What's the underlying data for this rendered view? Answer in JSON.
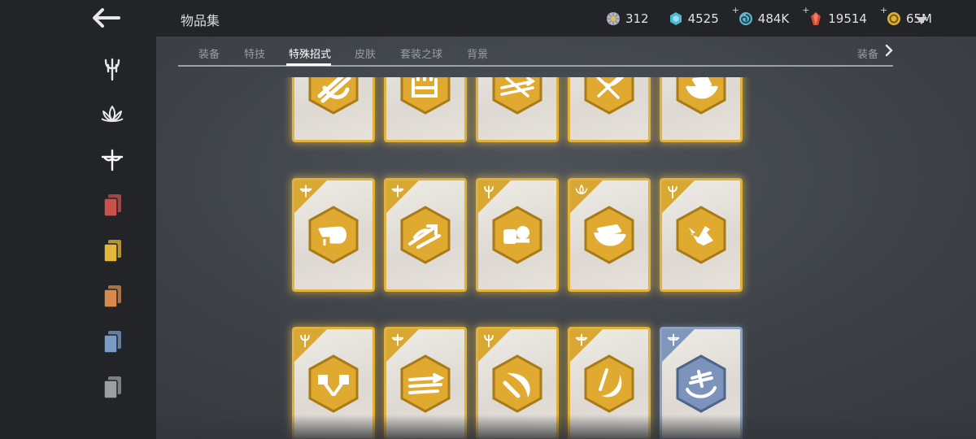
{
  "header": {
    "title": "物品集",
    "currencies": [
      {
        "icon": "prism-orb-icon",
        "value": "312",
        "color": "#c9a8e0"
      },
      {
        "icon": "cyan-hexagon-icon",
        "value": "4525",
        "color": "#4fb6d6"
      },
      {
        "icon": "swirl-orb-icon",
        "value": "484K",
        "color": "#63b6cc"
      },
      {
        "icon": "red-crystal-icon",
        "value": "19514",
        "color": "#d84a3a"
      },
      {
        "icon": "gold-coin-icon",
        "value": "65M",
        "color": "#d9b23a"
      }
    ]
  },
  "tabs": {
    "items": [
      "装备",
      "特技",
      "特殊招式",
      "皮肤",
      "套装之球",
      "背景"
    ],
    "active": "特殊招式",
    "right_label": "装备"
  },
  "sidebar": {
    "items": [
      {
        "icon": "trident-class-icon"
      },
      {
        "icon": "lotus-class-icon"
      },
      {
        "icon": "dragonfly-class-icon",
        "active": true
      },
      {
        "icon": "red-cards-icon",
        "color": "#c9534b"
      },
      {
        "icon": "yellow-cards-icon",
        "color": "#e4b63b"
      },
      {
        "icon": "orange-cards-icon",
        "color": "#d98a4e"
      },
      {
        "icon": "blue-cards-icon",
        "color": "#7b9cc9"
      },
      {
        "icon": "grey-cards-icon",
        "color": "#9c9ea3"
      }
    ]
  },
  "cards": {
    "rows": [
      [
        {
          "corner": "none",
          "symbol": "blade-slash-icon",
          "rarity": "gold"
        },
        {
          "corner": "none",
          "symbol": "castle-strike-icon",
          "rarity": "gold"
        },
        {
          "corner": "none",
          "symbol": "sword-arrows-icon",
          "rarity": "gold"
        },
        {
          "corner": "none",
          "symbol": "crossed-bow-icon",
          "rarity": "gold"
        },
        {
          "corner": "none",
          "symbol": "sweeping-kick-icon",
          "rarity": "gold"
        }
      ],
      [
        {
          "corner": "dragonfly-icon",
          "symbol": "fist-strike-icon",
          "rarity": "gold"
        },
        {
          "corner": "dragonfly-icon",
          "symbol": "arrow-dash-icon",
          "rarity": "gold"
        },
        {
          "corner": "trident-icon",
          "symbol": "shield-bash-icon",
          "rarity": "gold"
        },
        {
          "corner": "lotus-icon",
          "symbol": "swirl-kick-icon",
          "rarity": "gold"
        },
        {
          "corner": "trident-icon",
          "symbol": "rooster-icon",
          "rarity": "gold"
        }
      ],
      [
        {
          "corner": "trident-icon",
          "symbol": "double-hammer-icon",
          "rarity": "gold"
        },
        {
          "corner": "dragonfly-icon",
          "symbol": "blade-rush-icon",
          "rarity": "gold"
        },
        {
          "corner": "trident-icon",
          "symbol": "blade-arc-icon",
          "rarity": "gold"
        },
        {
          "corner": "dragonfly-icon",
          "symbol": "crescent-slash-icon",
          "rarity": "gold"
        },
        {
          "corner": "dragonfly-icon",
          "symbol": "spin-slash-icon",
          "rarity": "blue"
        }
      ]
    ]
  }
}
